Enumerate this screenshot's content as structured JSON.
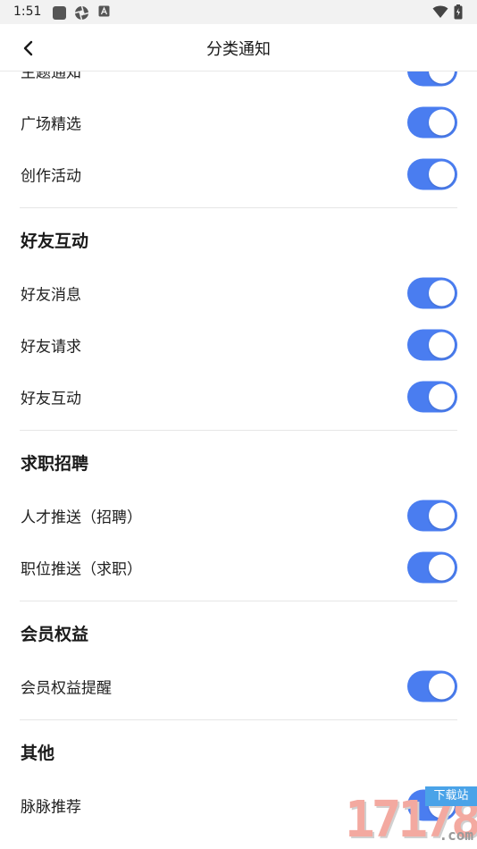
{
  "status_bar": {
    "time": "1:51"
  },
  "app_bar": {
    "title": "分类通知"
  },
  "sections": [
    {
      "title": "",
      "items": [
        {
          "label": "主题通知",
          "enabled": true
        },
        {
          "label": "广场精选",
          "enabled": true
        },
        {
          "label": "创作活动",
          "enabled": true
        }
      ]
    },
    {
      "title": "好友互动",
      "items": [
        {
          "label": "好友消息",
          "enabled": true
        },
        {
          "label": "好友请求",
          "enabled": true
        },
        {
          "label": "好友互动",
          "enabled": true
        }
      ]
    },
    {
      "title": "求职招聘",
      "items": [
        {
          "label": "人才推送（招聘）",
          "enabled": true
        },
        {
          "label": "职位推送（求职）",
          "enabled": true
        }
      ]
    },
    {
      "title": "会员权益",
      "items": [
        {
          "label": "会员权益提醒",
          "enabled": true
        }
      ]
    },
    {
      "title": "其他",
      "items": [
        {
          "label": "脉脉推荐",
          "enabled": true
        }
      ]
    }
  ],
  "watermark": {
    "number": "17178",
    "tag": "下载站",
    "suffix": ".com"
  },
  "colors": {
    "toggle_on": "#4a7df0",
    "divider": "#e6e6e6"
  }
}
